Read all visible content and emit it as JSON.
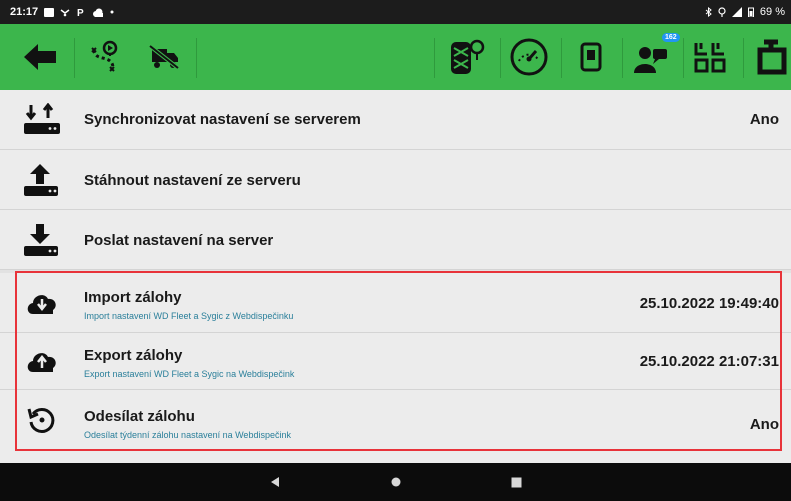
{
  "status_bar": {
    "time": "21:17",
    "battery": "69 %",
    "left_icons": [
      "notification-icon",
      "cast-icon",
      "parking-icon",
      "cloud-icon",
      "dot-icon"
    ],
    "right_icons": [
      "bluetooth-icon",
      "location-icon",
      "signal-icon",
      "battery-icon"
    ]
  },
  "toolbar": {
    "background": "#3cb64c",
    "badge_count": "162",
    "items": [
      "back-arrow-icon",
      "route-icon",
      "truck-off-icon",
      "tire-icon",
      "speedometer-icon",
      "fuel-icon",
      "driver-message-icon",
      "grid-icon",
      "app-logo-icon"
    ]
  },
  "settings": {
    "sync": {
      "title": "Synchronizovat nastavení se serverem",
      "value": "Ano"
    },
    "download": {
      "title": "Stáhnout nastavení ze serveru"
    },
    "upload": {
      "title": "Poslat nastavení na server"
    },
    "import_backup": {
      "title": "Import zálohy",
      "subtitle": "Import nastavení WD Fleet a Sygic z Webdispečinku",
      "value": "25.10.2022 19:49:40"
    },
    "export_backup": {
      "title": "Export zálohy",
      "subtitle": "Export nastavení WD Fleet a Sygic na Webdispečink",
      "value": "25.10.2022 21:07:31"
    },
    "send_backup": {
      "title": "Odesílat zálohu",
      "subtitle": "Odesílat týdenní zálohu nastavení na Webdispečink",
      "value": "Ano"
    }
  },
  "highlight_color": "#e8333a",
  "nav_bar": [
    "back-icon",
    "home-icon",
    "recents-icon"
  ]
}
